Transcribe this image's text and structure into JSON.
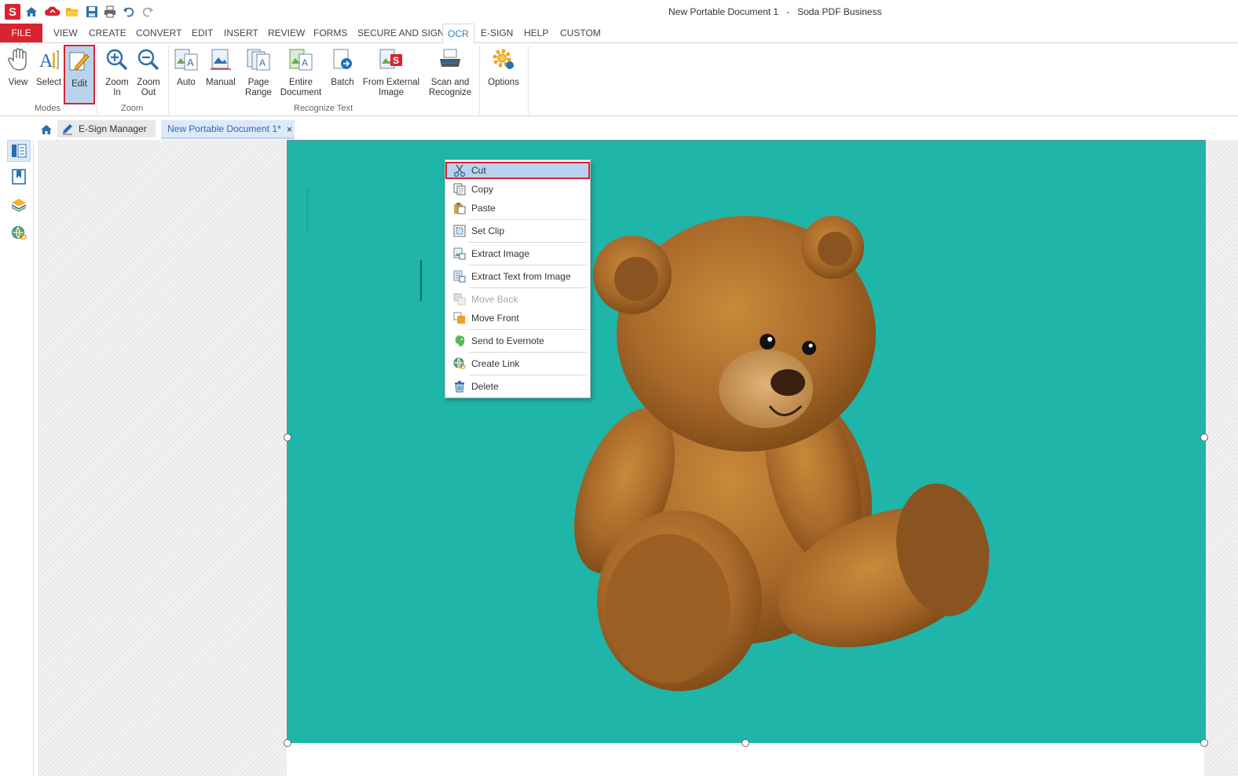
{
  "window": {
    "title": "New Portable Document 1   -   Soda PDF Business"
  },
  "menu": {
    "file": "FILE",
    "tabs": [
      "VIEW",
      "CREATE",
      "CONVERT",
      "EDIT",
      "INSERT",
      "REVIEW",
      "FORMS",
      "SECURE AND SIGN",
      "OCR",
      "E-SIGN",
      "HELP",
      "CUSTOM"
    ],
    "active": "OCR"
  },
  "ribbon": {
    "view": "View",
    "select": "Select",
    "edit": "Edit",
    "zoom_in_1": "Zoom",
    "zoom_in_2": "In",
    "zoom_out_1": "Zoom",
    "zoom_out_2": "Out",
    "auto": "Auto",
    "manual": "Manual",
    "page_range_1": "Page",
    "page_range_2": "Range",
    "entire_doc_1": "Entire",
    "entire_doc_2": "Document",
    "batch": "Batch",
    "from_ext_1": "From External",
    "from_ext_2": "Image",
    "scan_1": "Scan and",
    "scan_2": "Recognize",
    "options": "Options",
    "group_modes": "Modes",
    "group_zoom": "Zoom",
    "group_recognize": "Recognize Text"
  },
  "tabs": {
    "esign": "E-Sign Manager",
    "doc": "New Portable Document 1*",
    "close": "×"
  },
  "context_menu": {
    "items": [
      "Cut",
      "Copy",
      "Paste",
      "Set Clip",
      "Extract Image",
      "Extract Text from Image",
      "Move Back",
      "Move Front",
      "Send to Evernote",
      "Create Link",
      "Delete"
    ]
  },
  "colors": {
    "accent": "#d9232e",
    "page_bg": "#1fb5a8",
    "active_tab": "#2a7fc2"
  }
}
